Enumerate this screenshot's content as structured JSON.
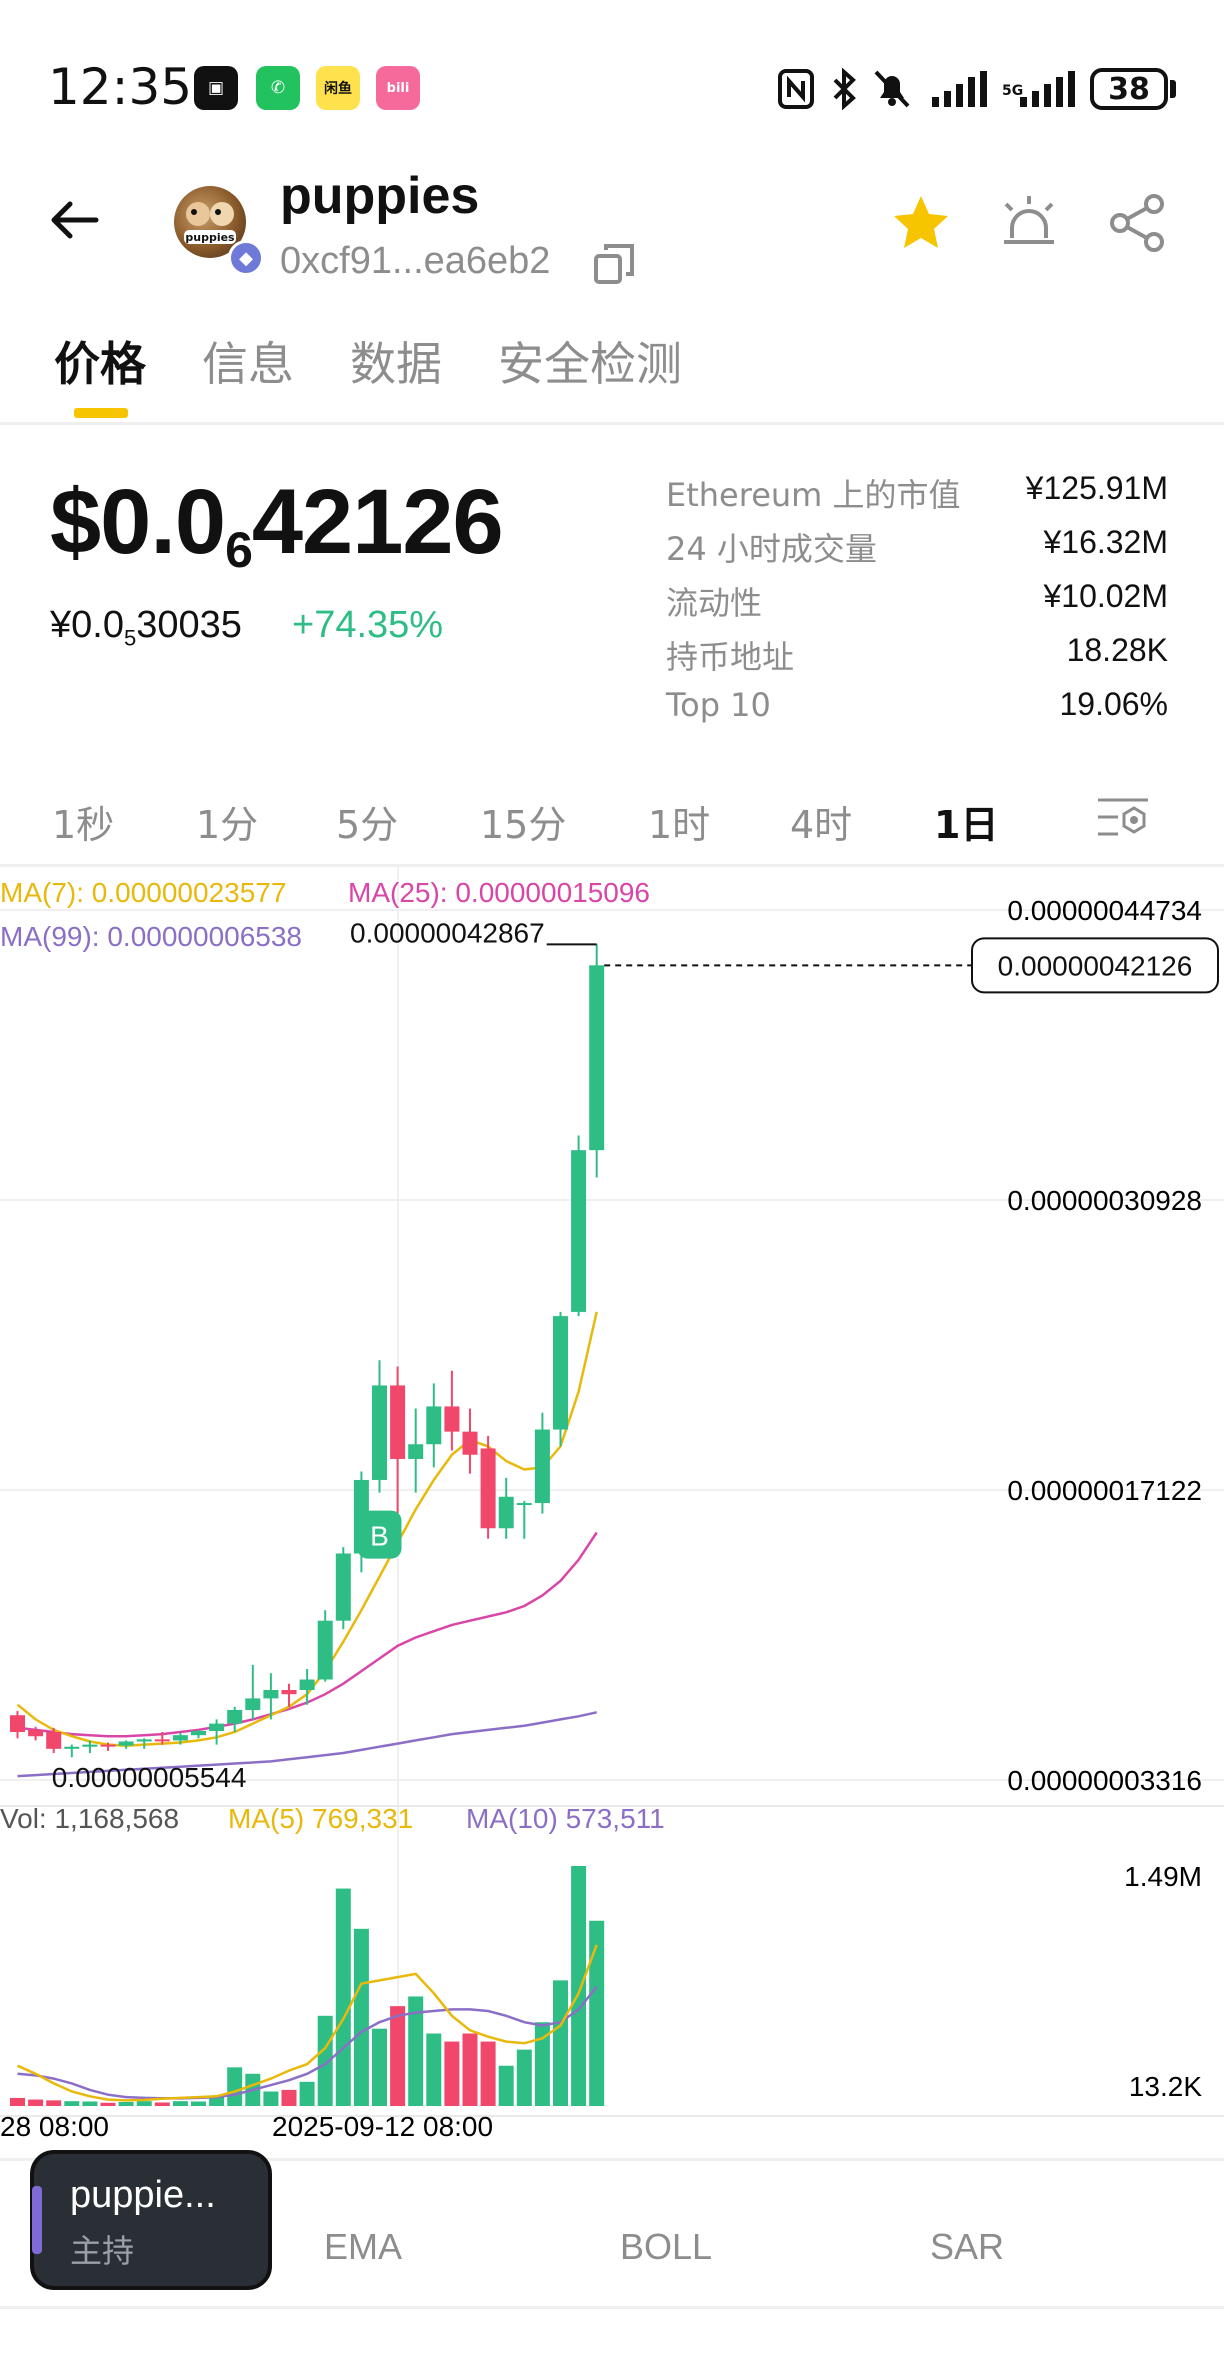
{
  "status_bar": {
    "time": "12:35",
    "battery": "38",
    "apps": [
      "okx-app-icon",
      "wechat-app-icon",
      "xianyu-app-icon",
      "bilibili-app-icon"
    ],
    "app_glyphs": [
      "▣",
      "✆",
      "闲鱼",
      "bili"
    ],
    "system_icons": [
      "nfc-icon",
      "bluetooth-icon",
      "mute-icon",
      "signal-icon",
      "signal-icon-2"
    ]
  },
  "header": {
    "token_name": "puppies",
    "address": "0xcf91...ea6eb2",
    "avatar_text": "puppies",
    "chain_icon": "ethereum-icon"
  },
  "tabs": [
    "价格",
    "信息",
    "数据",
    "安全检测"
  ],
  "price": {
    "main_prefix": "$0.0",
    "main_sub": "6",
    "main_suffix": "42126",
    "cny_prefix": "¥0.0",
    "cny_sub": "5",
    "cny_suffix": "30035",
    "change": "+74.35%"
  },
  "stats": [
    {
      "label": "Ethereum 上的市值",
      "value": "¥125.91M"
    },
    {
      "label": "24 小时成交量",
      "value": "¥16.32M"
    },
    {
      "label": "流动性",
      "value": "¥10.02M"
    },
    {
      "label": "持币地址",
      "value": "18.28K"
    },
    {
      "label": "Top 10",
      "value": "19.06%"
    }
  ],
  "intervals": [
    "1秒",
    "1分",
    "5分",
    "15分",
    "1时",
    "4时",
    "1日"
  ],
  "active_interval": "1日",
  "colors": {
    "up": "#2ebd85",
    "down": "#f0476b",
    "ma7": "#e8b90c",
    "ma25": "#d946a8",
    "ma99": "#8b6fc6",
    "accent": "#f7c500"
  },
  "chart": {
    "ma_labels": {
      "ma7": "MA(7): 0.00000023577",
      "ma25": "MA(25): 0.00000015096",
      "ma99": "MA(99): 0.00000006538"
    },
    "y_ticks": [
      "0.00000044734",
      "0.00000030928",
      "0.00000017122",
      "0.00000003316"
    ],
    "high_label": "0.00000042867",
    "low_label": "0.00000005544",
    "current_label": "0.00000042126",
    "buy_marker": "B",
    "volume_labels": {
      "vol": "Vol: 1,168,568",
      "ma5": "MA(5) 769,331",
      "ma10": "MA(10) 573,511"
    },
    "vol_ticks": [
      "1.49M",
      "13.2K"
    ],
    "x_ticks": [
      "28 08:00",
      "2025-09-12 08:00"
    ]
  },
  "chart_data": {
    "type": "candlestick",
    "price_axis": [
      3.316e-08,
      4.4734e-07
    ],
    "candles": [
      {
        "o": 6.4e-08,
        "h": 6.6e-08,
        "l": 5.3e-08,
        "c": 5.6e-08
      },
      {
        "o": 5.7e-08,
        "h": 5.85e-08,
        "l": 5.2e-08,
        "c": 5.4e-08
      },
      {
        "o": 5.6e-08,
        "h": 5.8e-08,
        "l": 4.6e-08,
        "c": 4.8e-08
      },
      {
        "o": 4.8e-08,
        "h": 5e-08,
        "l": 4.4e-08,
        "c": 4.9e-08
      },
      {
        "o": 4.9e-08,
        "h": 5.2e-08,
        "l": 4.6e-08,
        "c": 5e-08
      },
      {
        "o": 5e-08,
        "h": 5.1e-08,
        "l": 4.7e-08,
        "c": 4.95e-08
      },
      {
        "o": 4.95e-08,
        "h": 5.2e-08,
        "l": 4.8e-08,
        "c": 5.15e-08
      },
      {
        "o": 5.15e-08,
        "h": 5.3e-08,
        "l": 4.8e-08,
        "c": 5.25e-08
      },
      {
        "o": 5.25e-08,
        "h": 5.6e-08,
        "l": 5e-08,
        "c": 5.2e-08
      },
      {
        "o": 5.2e-08,
        "h": 5.55e-08,
        "l": 5e-08,
        "c": 5.45e-08
      },
      {
        "o": 5.45e-08,
        "h": 5.7e-08,
        "l": 5.3e-08,
        "c": 5.65e-08
      },
      {
        "o": 5.65e-08,
        "h": 6.2e-08,
        "l": 5e-08,
        "c": 6e-08
      },
      {
        "o": 6e-08,
        "h": 6.8e-08,
        "l": 5.6e-08,
        "c": 6.65e-08
      },
      {
        "o": 6.65e-08,
        "h": 8.8e-08,
        "l": 6.2e-08,
        "c": 7.2e-08
      },
      {
        "o": 7.2e-08,
        "h": 8.4e-08,
        "l": 6.2e-08,
        "c": 7.6e-08
      },
      {
        "o": 7.6e-08,
        "h": 7.9e-08,
        "l": 6.8e-08,
        "c": 7.4e-08
      },
      {
        "o": 7.6e-08,
        "h": 8.6e-08,
        "l": 6.9e-08,
        "c": 8.1e-08
      },
      {
        "o": 8.1e-08,
        "h": 1.14e-07,
        "l": 8e-08,
        "c": 1.09e-07
      },
      {
        "o": 1.09e-07,
        "h": 1.44e-07,
        "l": 1.05e-07,
        "c": 1.41e-07
      },
      {
        "o": 1.41e-07,
        "h": 1.8e-07,
        "l": 1.32e-07,
        "c": 1.76e-07
      },
      {
        "o": 1.76e-07,
        "h": 2.33e-07,
        "l": 1.7e-07,
        "c": 2.21e-07
      },
      {
        "o": 2.21e-07,
        "h": 2.3e-07,
        "l": 1.58e-07,
        "c": 1.86e-07
      },
      {
        "o": 1.86e-07,
        "h": 2.1e-07,
        "l": 1.7e-07,
        "c": 1.93e-07
      },
      {
        "o": 1.93e-07,
        "h": 2.22e-07,
        "l": 1.82e-07,
        "c": 2.11e-07
      },
      {
        "o": 2.11e-07,
        "h": 2.28e-07,
        "l": 1.9e-07,
        "c": 1.99e-07
      },
      {
        "o": 1.99e-07,
        "h": 2.1e-07,
        "l": 1.79e-07,
        "c": 1.88e-07
      },
      {
        "o": 1.91e-07,
        "h": 1.97e-07,
        "l": 1.48e-07,
        "c": 1.53e-07
      },
      {
        "o": 1.53e-07,
        "h": 1.77e-07,
        "l": 1.48e-07,
        "c": 1.68e-07
      },
      {
        "o": 1.65e-07,
        "h": 1.66e-07,
        "l": 1.48e-07,
        "c": 1.65e-07
      },
      {
        "o": 1.65e-07,
        "h": 2.08e-07,
        "l": 1.6e-07,
        "c": 2e-07
      },
      {
        "o": 2e-07,
        "h": 2.56e-07,
        "l": 1.92e-07,
        "c": 2.54e-07
      },
      {
        "o": 2.56e-07,
        "h": 3.4e-07,
        "l": 2.54e-07,
        "c": 3.33e-07
      },
      {
        "o": 3.33e-07,
        "h": 4.31e-07,
        "l": 3.2e-07,
        "c": 4.21e-07
      }
    ],
    "ma7": [
      6.9e-08,
      6.2e-08,
      5.7e-08,
      5.4e-08,
      5.15e-08,
      5e-08,
      4.95e-08,
      5e-08,
      5.05e-08,
      5.1e-08,
      5.2e-08,
      5.35e-08,
      5.6e-08,
      6e-08,
      6.4e-08,
      6.8e-08,
      7.4e-08,
      8.5e-08,
      9.9e-08,
      1.14e-07,
      1.3e-07,
      1.46e-07,
      1.62e-07,
      1.76e-07,
      1.88e-07,
      1.95e-07,
      1.92e-07,
      1.85e-07,
      1.81e-07,
      1.82e-07,
      1.92e-07,
      2.18e-07,
      2.56e-07
    ],
    "ma25": [
      5.8e-08,
      5.7e-08,
      5.6e-08,
      5.5e-08,
      5.45e-08,
      5.4e-08,
      5.4e-08,
      5.45e-08,
      5.5e-08,
      5.6e-08,
      5.7e-08,
      5.85e-08,
      6e-08,
      6.2e-08,
      6.45e-08,
      6.7e-08,
      7e-08,
      7.4e-08,
      7.9e-08,
      8.5e-08,
      9.1e-08,
      9.7e-08,
      1.01e-07,
      1.04e-07,
      1.07e-07,
      1.09e-07,
      1.11e-07,
      1.13e-07,
      1.16e-07,
      1.21e-07,
      1.28e-07,
      1.38e-07,
      1.51e-07
    ],
    "ma99": [
      3.5e-08,
      3.55e-08,
      3.6e-08,
      3.65e-08,
      3.7e-08,
      3.75e-08,
      3.8e-08,
      3.85e-08,
      3.9e-08,
      3.95e-08,
      4e-08,
      4.05e-08,
      4.1e-08,
      4.15e-08,
      4.2e-08,
      4.3e-08,
      4.4e-08,
      4.5e-08,
      4.6e-08,
      4.75e-08,
      4.9e-08,
      5.05e-08,
      5.2e-08,
      5.35e-08,
      5.5e-08,
      5.6e-08,
      5.7e-08,
      5.8e-08,
      5.9e-08,
      6.05e-08,
      6.2e-08,
      6.35e-08,
      6.54e-08
    ],
    "volume_axis": [
      13200,
      1490000
    ],
    "volumes": [
      50000,
      40000,
      35000,
      30000,
      28000,
      20000,
      25000,
      30000,
      22000,
      30000,
      28000,
      60000,
      240000,
      200000,
      90000,
      100000,
      150000,
      560000,
      1350000,
      1100000,
      480000,
      620000,
      680000,
      450000,
      400000,
      450000,
      400000,
      250000,
      350000,
      520000,
      780000,
      1490000,
      1150000
    ],
    "vol_ma5": [
      250000,
      200000,
      140000,
      90000,
      60000,
      40000,
      35000,
      38000,
      45000,
      50000,
      55000,
      60000,
      90000,
      130000,
      170000,
      220000,
      260000,
      360000,
      540000,
      760000,
      780000,
      800000,
      820000,
      700000,
      560000,
      470000,
      430000,
      400000,
      390000,
      420000,
      500000,
      700000,
      1000000
    ],
    "vol_ma10": [
      200000,
      190000,
      170000,
      140000,
      100000,
      70000,
      55000,
      50000,
      48000,
      47000,
      50000,
      55000,
      70000,
      100000,
      130000,
      160000,
      200000,
      260000,
      360000,
      460000,
      520000,
      560000,
      580000,
      590000,
      600000,
      600000,
      590000,
      560000,
      520000,
      500000,
      520000,
      600000,
      740000
    ]
  },
  "indicators": [
    "EMA",
    "BOLL",
    "SAR"
  ],
  "floating": {
    "title": "puppie...",
    "subtitle": "主持"
  }
}
